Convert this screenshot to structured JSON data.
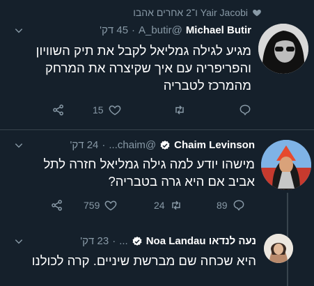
{
  "social_context": {
    "text": "Yair Jacobi ו־2 אחרים אהבו",
    "icon": "heart-icon"
  },
  "tweets": [
    {
      "name": "Michael Butir",
      "handle": "@A_butir",
      "time": "45 דק'",
      "verified": false,
      "text": "מגיע לגילה גמליאל לקבל את תיק השוויון והפריפריה עם איך שקיצרה את המרחק מהמרכז לטבריה",
      "reply_count": "",
      "retweet_count": "",
      "like_count": "15"
    },
    {
      "name": "Chaim Levinson",
      "handle": "@chaim...",
      "time": "24 דק'",
      "verified": true,
      "text": "מישהו יודע למה גילה גמליאל חזרה לתל אביב אם היא גרה בטבריה?",
      "reply_count": "89",
      "retweet_count": "24",
      "like_count": "759"
    },
    {
      "name": "נעה לנדאו Noa Landau",
      "handle": "...",
      "time": "23 דק'",
      "verified": true,
      "text": "היא שכחה שם מברשת שיניים. קרה לכולנו"
    }
  ],
  "colors": {
    "background": "#15202b",
    "secondary_text": "#8899a6",
    "divider": "#38444d",
    "verified": "#ffffff"
  }
}
